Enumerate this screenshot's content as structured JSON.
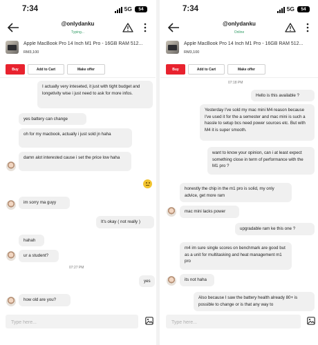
{
  "left": {
    "status": {
      "time": "7:34",
      "network": "5G",
      "battery": "54"
    },
    "header": {
      "username": "@onlydanku",
      "status": "Typing..."
    },
    "product": {
      "title": "Apple MacBook Pro 14 Inch M1 Pro - 16GB RAM 512...",
      "price": "RM3,100"
    },
    "actions": {
      "buy": "Buy",
      "cart": "Add to Cart",
      "offer": "Make offer"
    },
    "messages": {
      "m1": "I actually very inteseted, it just with tight budget and longetivity wise i just need to ask for more infos.",
      "m2": "yes battery can change",
      "m3": "oh for my macbook, actually i just sold jn haha",
      "m4": "damn alot interested cause i set the price low haha",
      "m5": "im sorry ma guyy",
      "m6": "It's okay ( not really )",
      "m7": "hahah",
      "m8": "ur a student?",
      "ts1": "07:27 PM",
      "m9": "yes",
      "m10": "how old are you?"
    },
    "composer": {
      "placeholder": "Type here..."
    }
  },
  "right": {
    "status": {
      "time": "7:34",
      "network": "5G",
      "battery": "54"
    },
    "header": {
      "username": "@onlydanku",
      "status": "Online"
    },
    "product": {
      "title": "Apple MacBook Pro 14 Inch M1 Pro - 16GB RAM 512...",
      "price": "RM3,100"
    },
    "actions": {
      "buy": "Buy",
      "cart": "Add to Cart",
      "offer": "Make offer"
    },
    "messages": {
      "ts1": "07:18 PM",
      "m1": "Hello is this available ?",
      "m2": "Yesterday I've sold my mac mini M4 reason because I've used it for the a semester and mac mini is such a hassle to setup bcs need power sources etc. But with M4 it is super smooth.",
      "m3": "want to know your opinion, can i at least expect something close in term of performance with the M1 pro ?",
      "m4": "honestly the chip in the m1 pro is solid, my only advice, get more ram",
      "m5": "mac mini lacks power",
      "m6": "upgradable ram ke this one ?",
      "m7": "m4 im sure single scores on benchmark are good but as a unit for multitasking and heat management m1 pro",
      "m8": "its not haha",
      "m9": "Also because I saw the battery health already 80+ is possible to change or is that any way to"
    },
    "composer": {
      "placeholder": "Type here..."
    }
  },
  "colors": {
    "accent": "#e8222e",
    "online": "#2f9b63",
    "bubble": "#f0f0f0"
  },
  "icons": [
    "back-arrow-icon",
    "report-warning-icon",
    "more-vertical-icon",
    "image-attach-icon",
    "signal-icon",
    "battery-icon",
    "emoji-icon"
  ]
}
